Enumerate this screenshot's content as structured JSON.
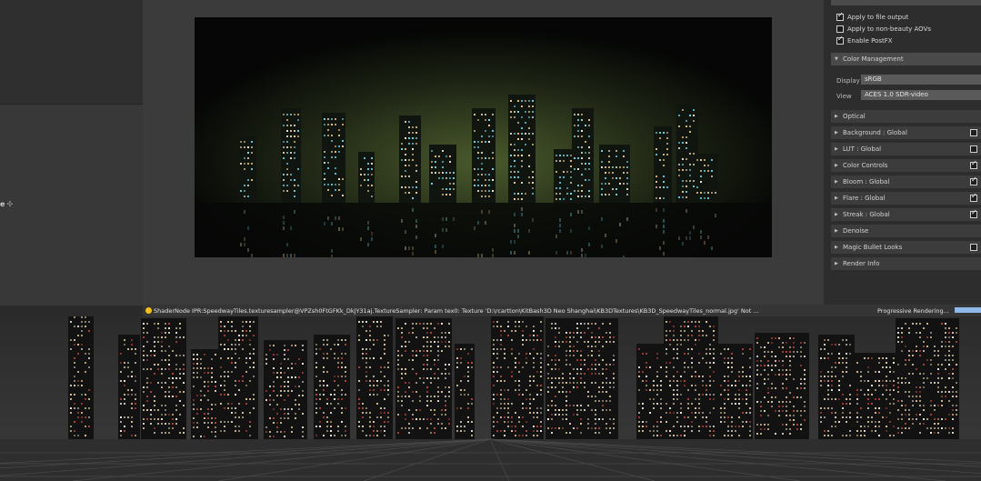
{
  "left_panel": {
    "cursor_label": "e",
    "cursor_icon": "move-icon"
  },
  "render_view": {
    "image": "rendered night city skyline preview"
  },
  "settings": {
    "general_checks": [
      {
        "label": "Apply to file output",
        "checked": true
      },
      {
        "label": "Apply to non-beauty AOVs",
        "checked": false
      },
      {
        "label": "Enable PostFX",
        "checked": true
      }
    ],
    "color_management": {
      "title": "Color Management",
      "display_label": "Display",
      "display_value": "sRGB",
      "view_label": "View",
      "view_value": "ACES 1.0 SDR-video"
    },
    "sections": [
      {
        "label": "Optical",
        "has_checkbox": false,
        "checked": false
      },
      {
        "label": "Background  : Global",
        "has_checkbox": true,
        "checked": false
      },
      {
        "label": "LUT  : Global",
        "has_checkbox": true,
        "checked": false
      },
      {
        "label": "Color Controls",
        "has_checkbox": true,
        "checked": true
      },
      {
        "label": "Bloom  : Global",
        "has_checkbox": true,
        "checked": true
      },
      {
        "label": "Flare  : Global",
        "has_checkbox": true,
        "checked": true
      },
      {
        "label": "Streak  : Global",
        "has_checkbox": true,
        "checked": true
      },
      {
        "label": "Denoise",
        "has_checkbox": false,
        "checked": false
      },
      {
        "label": "Magic Bullet Looks",
        "has_checkbox": true,
        "checked": false
      },
      {
        "label": "Render Info",
        "has_checkbox": false,
        "checked": false
      }
    ]
  },
  "status": {
    "message": "ShaderNode IPR:SpeedwayTiles.texturesampler@VPZsh0FtGFKk_DkjY31aj.TextureSampler: Param tex0: Texture 'D:\\rcartton\\KitBash3D Neo Shanghai\\KB3DTextures\\KB3D_SpeedwayTiles_normal.jpg' Not ...",
    "progress_label": "Progressive Rendering...",
    "progress_color": "#8fb7e8",
    "dot_color": "#f3c11c"
  },
  "viewport": {
    "content": "3D viewport city scene"
  }
}
